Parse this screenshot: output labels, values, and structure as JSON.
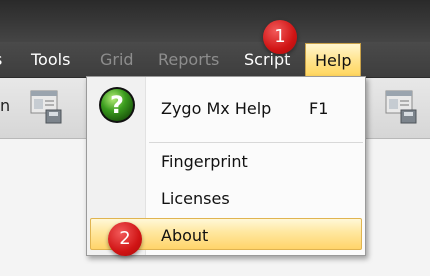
{
  "menubar": {
    "items": [
      {
        "label": "Tools",
        "enabled": true
      },
      {
        "label": "Grid",
        "enabled": false
      },
      {
        "label": "Reports",
        "enabled": false
      },
      {
        "label": "Script",
        "enabled": true
      },
      {
        "label": "Help",
        "enabled": true,
        "active": true
      }
    ]
  },
  "toolbar": {
    "partial_label": "n",
    "icons": [
      "form-window-icon",
      "form-window-icon"
    ]
  },
  "help_menu": {
    "items": [
      {
        "label": "Zygo Mx Help",
        "shortcut": "F1",
        "icon": "help-question-icon"
      },
      {
        "label": "Fingerprint"
      },
      {
        "label": "Licenses"
      },
      {
        "label": "About",
        "highlighted": true
      }
    ]
  },
  "annotations": {
    "step1": "1",
    "step2": "2"
  },
  "colors": {
    "menubar_bg": "#404040",
    "highlight": "#ffe48f",
    "badge": "#d01414",
    "help_icon_green": "#3a9c1e"
  }
}
